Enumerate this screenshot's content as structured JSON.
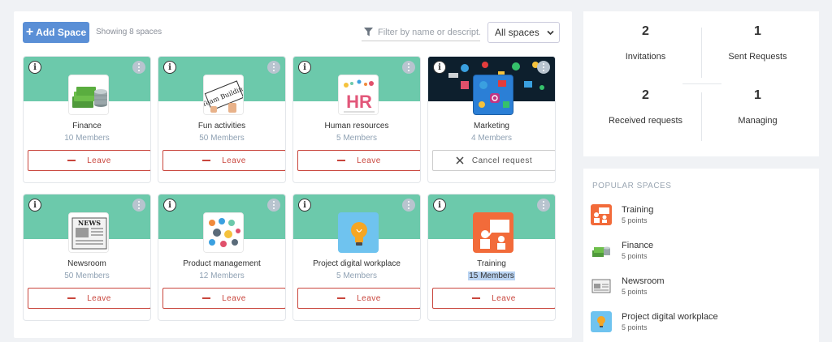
{
  "toolbar": {
    "add_label": "Add Space",
    "showing": "Showing 8 spaces",
    "filter_placeholder": "Filter by name or descript...",
    "select_value": "All spaces"
  },
  "spaces": [
    {
      "name": "Finance",
      "members": "10 Members",
      "action": "Leave"
    },
    {
      "name": "Fun activities",
      "members": "50 Members",
      "action": "Leave"
    },
    {
      "name": "Human resources",
      "members": "5 Members",
      "action": "Leave"
    },
    {
      "name": "Marketing",
      "members": "4 Members",
      "action": "Cancel request"
    },
    {
      "name": "Newsroom",
      "members": "50 Members",
      "action": "Leave"
    },
    {
      "name": "Product management",
      "members": "12 Members",
      "action": "Leave"
    },
    {
      "name": "Project digital workplace",
      "members": "5 Members",
      "action": "Leave"
    },
    {
      "name": "Training",
      "members": "15 Members",
      "action": "Leave"
    }
  ],
  "stats": {
    "invitations": {
      "num": "2",
      "label": "Invitations"
    },
    "sent": {
      "num": "1",
      "label": "Sent Requests"
    },
    "received": {
      "num": "2",
      "label": "Received requests"
    },
    "managing": {
      "num": "1",
      "label": "Managing"
    }
  },
  "popular": {
    "title": "POPULAR SPACES",
    "items": [
      {
        "name": "Training",
        "points": "5 points"
      },
      {
        "name": "Finance",
        "points": "5 points"
      },
      {
        "name": "Newsroom",
        "points": "5 points"
      },
      {
        "name": "Project digital workplace",
        "points": "5 points"
      }
    ]
  },
  "thumb_texts": {
    "team_building": "Team Building",
    "hr": "HR",
    "news": "NEWS"
  },
  "colors": {
    "banner": "#6cc9ab",
    "accent": "#5a8fd6",
    "leave": "#c9463d"
  }
}
